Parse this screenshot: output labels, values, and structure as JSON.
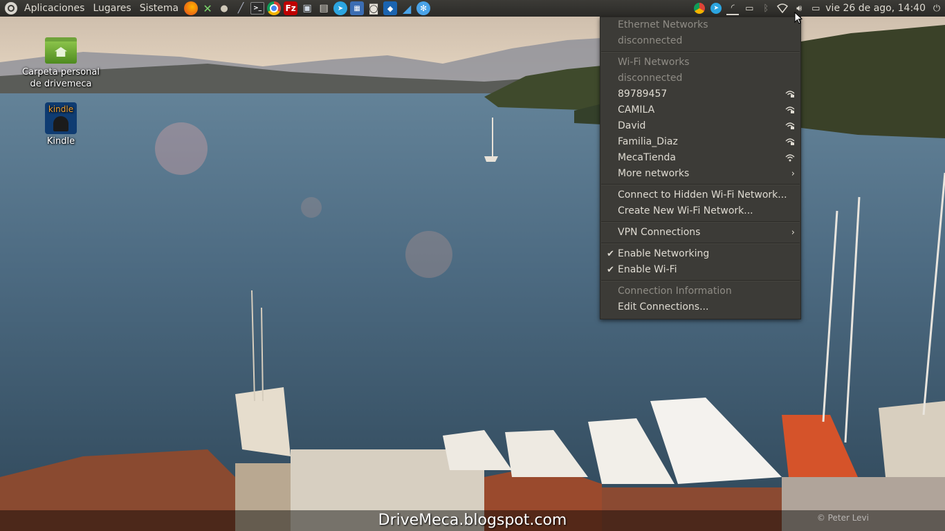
{
  "panel": {
    "menus": [
      "Aplicaciones",
      "Lugares",
      "Sistema"
    ],
    "launchers": [
      "firefox-icon",
      "network-tool-icon",
      "dog-icon",
      "wand-icon",
      "terminal-icon",
      "chrome-icon",
      "filezilla-icon",
      "remote-desktop-icon",
      "printer-icon",
      "telegram-icon",
      "calculator-icon",
      "camera-icon",
      "virtualbox-icon",
      "sail-icon",
      "snowflake-icon"
    ],
    "tray_icons": [
      "chrome-tray-icon",
      "telegram-tray-icon",
      "signal-tray-icon",
      "drive-tray-icon",
      "bluetooth-icon",
      "wifi-icon",
      "volume-icon",
      "battery-icon"
    ],
    "clock": "vie 26 de ago, 14:40",
    "power_icon": "power-icon"
  },
  "desktop": {
    "icons": [
      {
        "label": "Carpeta personal de drivemeca",
        "icon": "home-folder-icon"
      },
      {
        "label": "Kindle",
        "icon": "kindle-icon",
        "badge": "kindle"
      }
    ]
  },
  "network_menu": {
    "ethernet_header": "Ethernet Networks",
    "ethernet_status": "disconnected",
    "wifi_header": "Wi-Fi Networks",
    "wifi_status": "disconnected",
    "networks": [
      "89789457",
      "CAMILA",
      "David",
      "Familia_Diaz",
      "MecaTienda"
    ],
    "more_networks": "More networks",
    "connect_hidden": "Connect to Hidden Wi-Fi Network...",
    "create_new": "Create New Wi-Fi Network...",
    "vpn": "VPN Connections",
    "enable_networking": "Enable Networking",
    "enable_wifi": "Enable Wi-Fi",
    "connection_info": "Connection Information",
    "edit_connections": "Edit Connections..."
  },
  "watermark": "DriveMeca.blogspot.com",
  "credit": "© Peter Levi",
  "colors": {
    "panel_bg": "#3c3b37",
    "menu_text": "#dfdbd2",
    "disabled_text": "#8f8c85"
  }
}
